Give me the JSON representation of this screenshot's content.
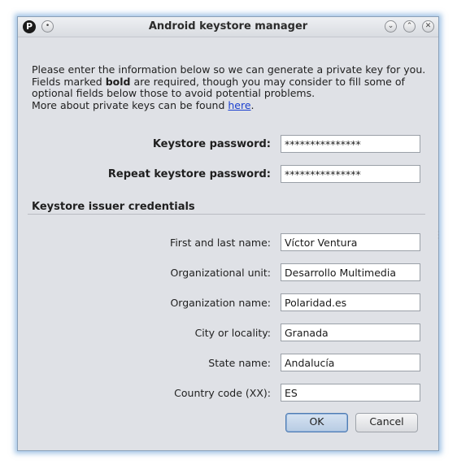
{
  "window": {
    "title": "Android keystore manager",
    "app_icon_glyph": "P",
    "app_icon": "pidgin-p-icon",
    "buttons": {
      "menu_icon": "dot-menu-icon",
      "minimize_icon": "chevron-down-icon",
      "maximize_icon": "chevron-up-icon",
      "close_icon": "close-icon"
    }
  },
  "intro": {
    "line1": "Please enter the information below so we can generate a private key for you.",
    "line2_pre": "Fields marked ",
    "line2_bold": "bold",
    "line2_post": " are required, though you may consider to fill some of",
    "line3": "optional fields below those to avoid potential problems.",
    "line4_pre": "More about private keys can be found ",
    "line4_link": "here",
    "line4_post": "."
  },
  "required_fields": {
    "keystore_password_label": "Keystore password:",
    "keystore_password_value": "***************",
    "repeat_password_label": "Repeat keystore password:",
    "repeat_password_value": "***************"
  },
  "issuer": {
    "section_title": "Keystore issuer credentials",
    "fields": [
      {
        "label": "First and last name:",
        "value": "Víctor Ventura"
      },
      {
        "label": "Organizational unit:",
        "value": "Desarrollo Multimedia"
      },
      {
        "label": "Organization name:",
        "value": "Polaridad.es"
      },
      {
        "label": "City or locality:",
        "value": "Granada"
      },
      {
        "label": "State name:",
        "value": "Andalucía"
      },
      {
        "label": "Country code (XX):",
        "value": "ES"
      }
    ]
  },
  "actions": {
    "ok_label": "OK",
    "cancel_label": "Cancel"
  }
}
